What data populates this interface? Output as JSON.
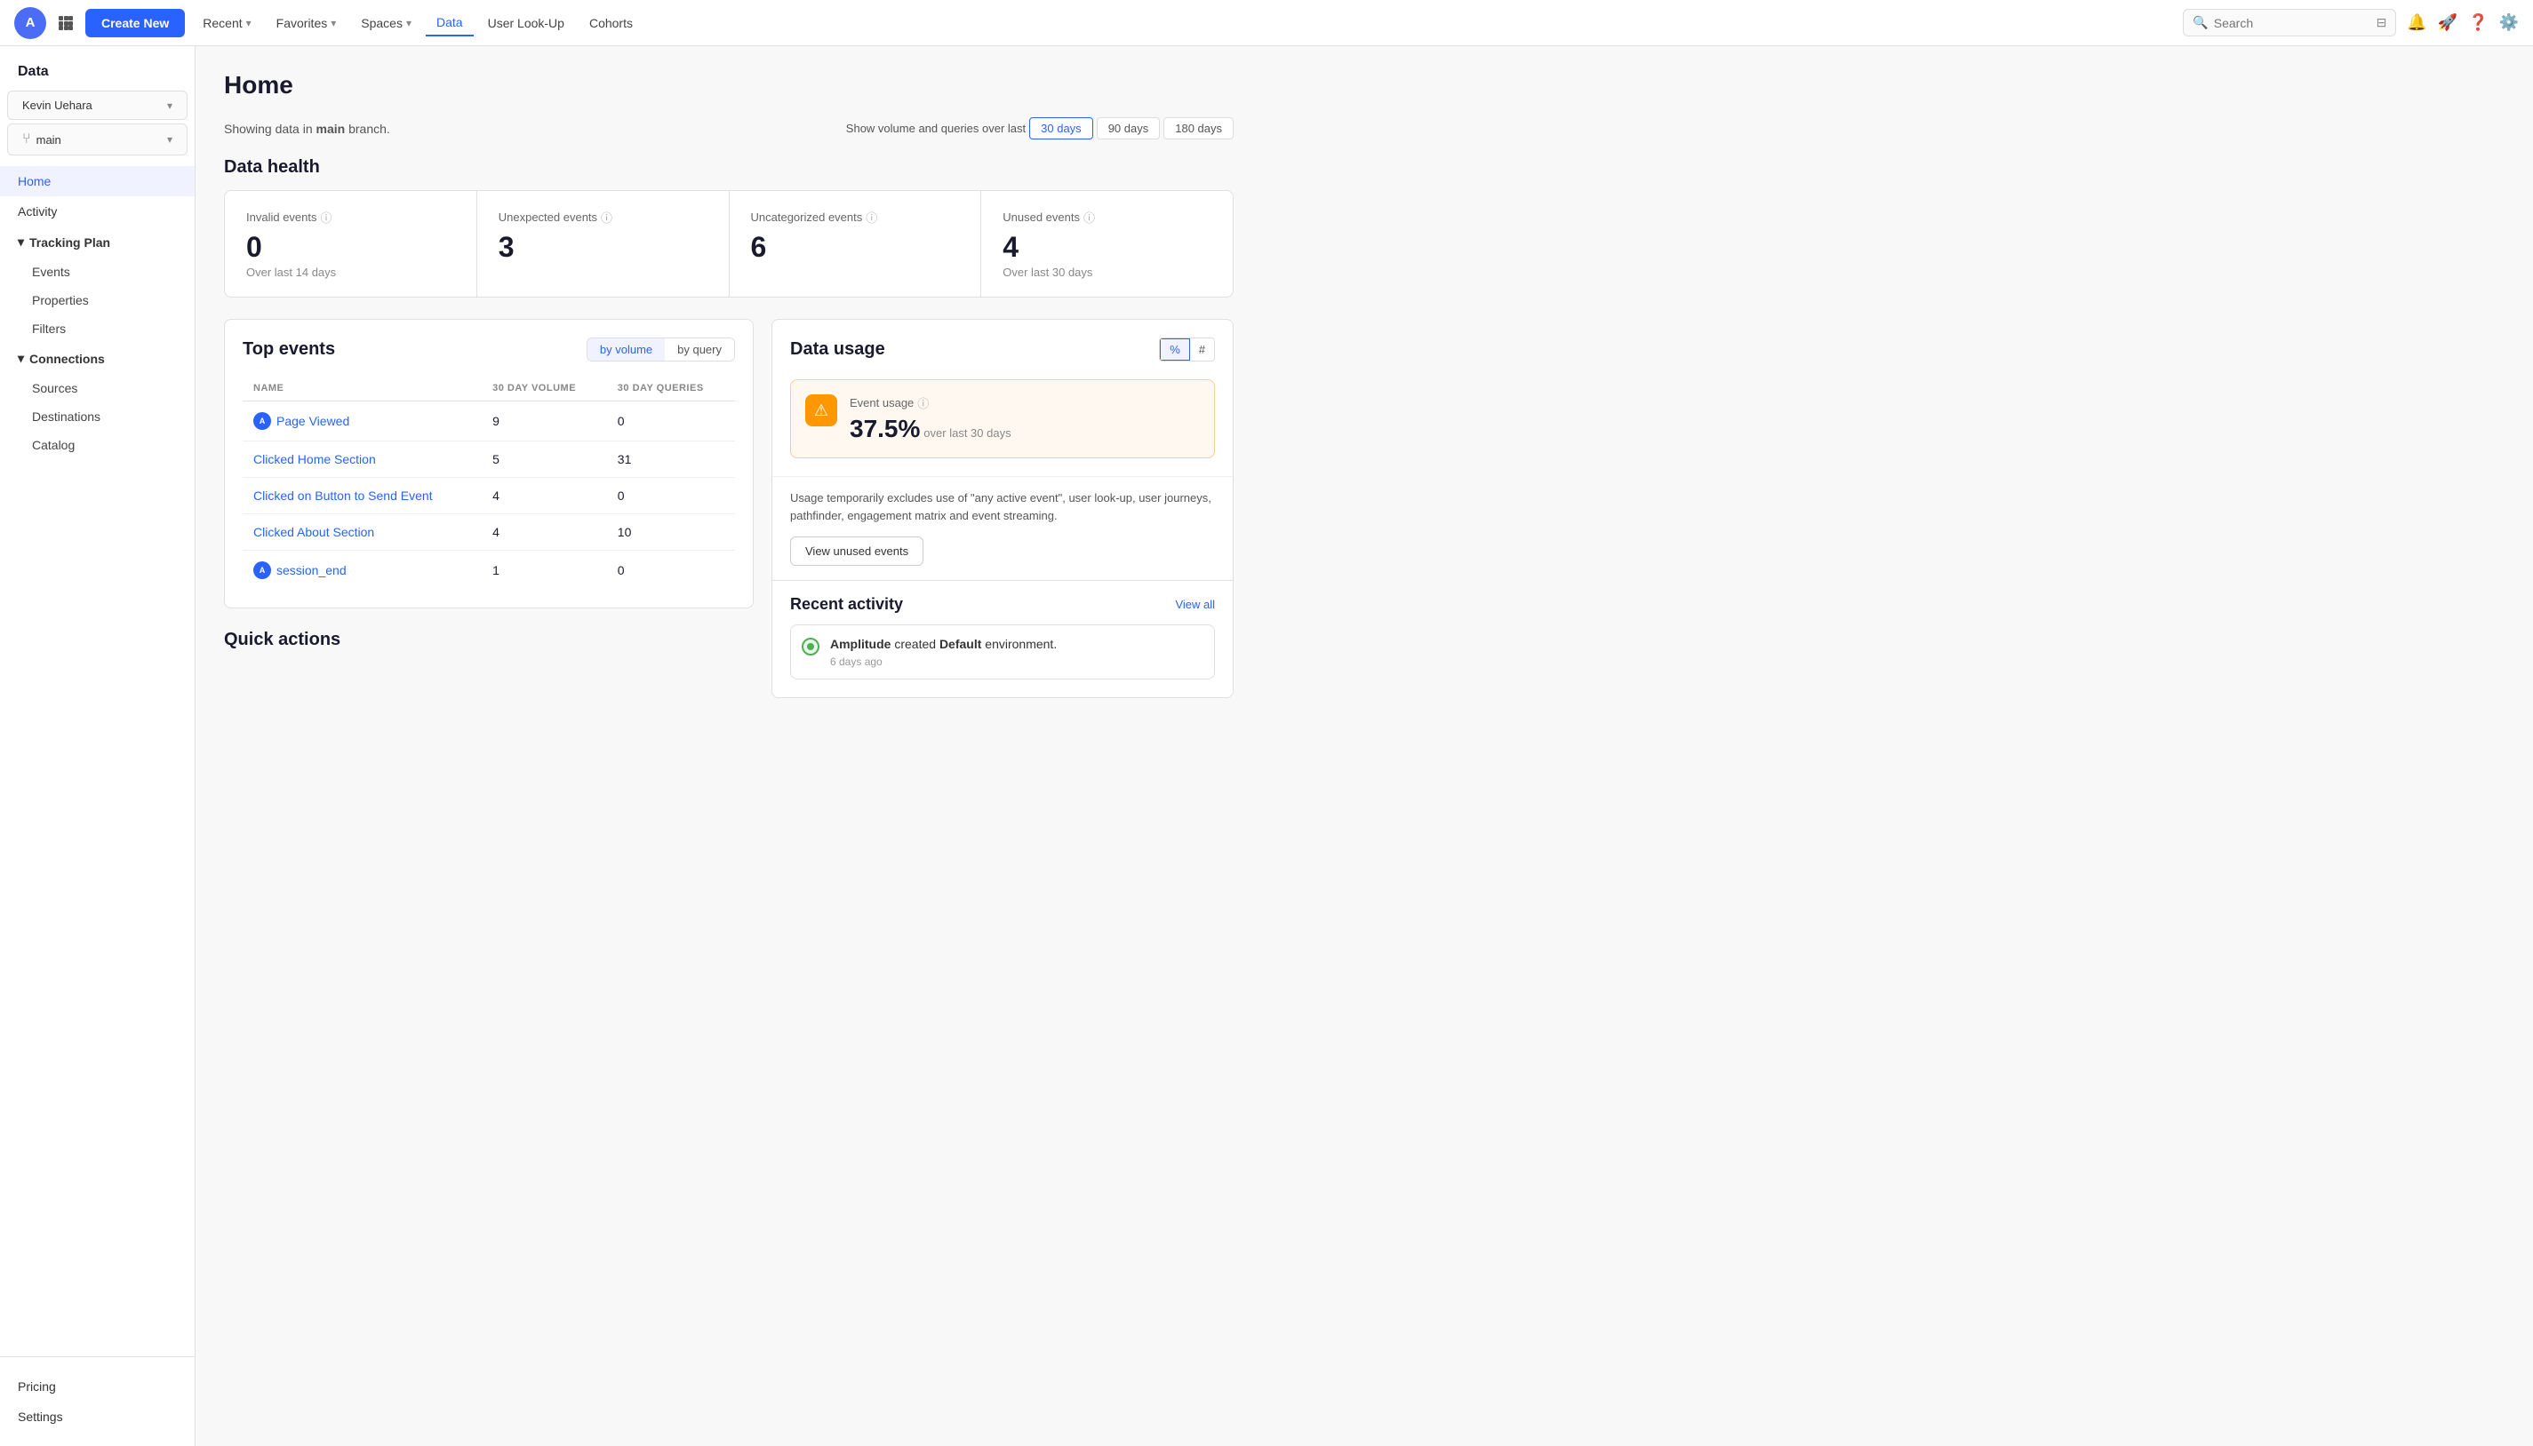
{
  "app": {
    "logo_text": "A",
    "logo_bg": "#4a6cf7"
  },
  "topnav": {
    "create_new": "Create New",
    "items": [
      {
        "label": "Recent",
        "has_chevron": true,
        "active": false
      },
      {
        "label": "Favorites",
        "has_chevron": true,
        "active": false
      },
      {
        "label": "Spaces",
        "has_chevron": true,
        "active": false
      },
      {
        "label": "Data",
        "has_chevron": false,
        "active": true
      },
      {
        "label": "User Look-Up",
        "has_chevron": false,
        "active": false
      },
      {
        "label": "Cohorts",
        "has_chevron": false,
        "active": false
      }
    ],
    "search_placeholder": "Search"
  },
  "sidebar": {
    "section_title": "Data",
    "workspace": "Kevin Uehara",
    "branch": "main",
    "nav_items": [
      {
        "label": "Home",
        "active": true
      },
      {
        "label": "Activity",
        "active": false
      }
    ],
    "tracking_plan": {
      "label": "Tracking Plan",
      "items": [
        "Events",
        "Properties",
        "Filters"
      ]
    },
    "connections": {
      "label": "Connections",
      "items": [
        "Sources",
        "Destinations",
        "Catalog"
      ]
    },
    "bottom_items": [
      "Pricing",
      "Settings"
    ]
  },
  "main": {
    "title": "Home",
    "branch_note": "Showing data in",
    "branch_name": "main",
    "branch_note_suffix": "branch.",
    "time_filter_label": "Show volume and queries over last",
    "time_options": [
      "30 days",
      "90 days",
      "180 days"
    ],
    "active_time": "30 days",
    "data_health": {
      "title": "Data health",
      "metrics": [
        {
          "label": "Invalid events",
          "value": "0",
          "sub": "Over last 14 days"
        },
        {
          "label": "Unexpected events",
          "value": "3",
          "sub": ""
        },
        {
          "label": "Uncategorized events",
          "value": "6",
          "sub": ""
        },
        {
          "label": "Unused events",
          "value": "4",
          "sub": "Over last 30 days"
        }
      ]
    },
    "top_events": {
      "title": "Top events",
      "toggle_options": [
        "by volume",
        "by query"
      ],
      "active_toggle": "by volume",
      "columns": [
        "NAME",
        "30 DAY VOLUME",
        "30 DAY QUERIES"
      ],
      "rows": [
        {
          "name": "Page Viewed",
          "volume": "9",
          "queries": "0",
          "has_icon": true
        },
        {
          "name": "Clicked Home Section",
          "volume": "5",
          "queries": "31",
          "has_icon": false
        },
        {
          "name": "Clicked on Button to Send Event",
          "volume": "4",
          "queries": "0",
          "has_icon": false
        },
        {
          "name": "Clicked About Section",
          "volume": "4",
          "queries": "10",
          "has_icon": false
        },
        {
          "name": "session_end",
          "volume": "1",
          "queries": "0",
          "has_icon": true
        }
      ]
    },
    "data_usage": {
      "title": "Data usage",
      "toggle_options": [
        "%",
        "#"
      ],
      "active_toggle": "%",
      "event_usage": {
        "label": "Event usage",
        "percent": "37.5%",
        "over": "over last 30 days"
      },
      "usage_note": "Usage temporarily excludes use of \"any active event\", user look-up, user journeys, pathfinder, engagement matrix and event streaming.",
      "view_unused_btn": "View unused events",
      "recent_activity": {
        "title": "Recent activity",
        "view_all": "View all",
        "items": [
          {
            "text_before": "Amplitude",
            "bold": "created",
            "text_after": "Default",
            "bold2": "environment.",
            "time": "6 days ago"
          }
        ]
      }
    },
    "quick_actions": {
      "title": "Quick actions"
    }
  }
}
